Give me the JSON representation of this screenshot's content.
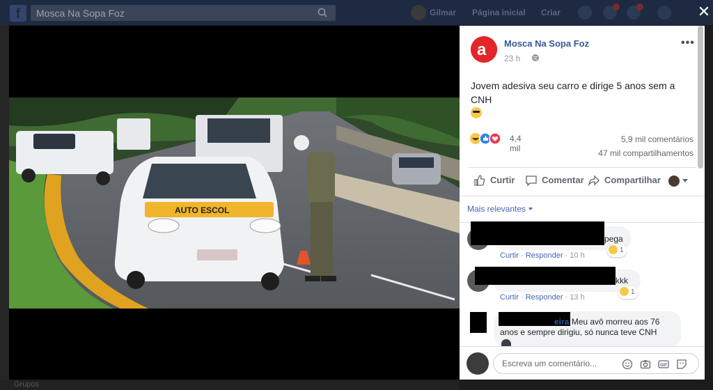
{
  "topbar": {
    "search_value": "Mosca Na Sopa Foz",
    "nav": [
      "Gilmar",
      "Página inicial",
      "Criar"
    ]
  },
  "post": {
    "page_name": "Mosca Na Sopa Foz",
    "time": "23 h",
    "text": "Jovem adesiva seu carro e dirige 5 anos sem a CNH",
    "reactions_count": "4,4 mil",
    "comments_count": "5,9 mil comentários",
    "shares_count": "47 mil compartilhamentos",
    "actions": {
      "like": "Curtir",
      "comment": "Comentar",
      "share": "Compartilhar"
    },
    "filter_label": "Mais relevantes",
    "photo_car_text": "AUTO ESCOL"
  },
  "comments": [
    {
      "text_end": "pega",
      "reaction_count": "1",
      "like": "Curtir",
      "reply": "Responder",
      "time": "10 h"
    },
    {
      "text_end": "kkk",
      "reaction_count": "1",
      "like": "Curtir",
      "reply": "Responder",
      "time": "13 h"
    },
    {
      "name_fragment": "eira",
      "text": "Meu avô morreu aos 76 anos e sempre dirigiu, só nunca teve CNH"
    }
  ],
  "composer": {
    "placeholder": "Escreva um comentário..."
  },
  "background_text": "Grupos",
  "colors": {
    "facebook_blue": "#4267b2",
    "page_name_blue": "#365899",
    "topbar": "#1d2a42"
  }
}
